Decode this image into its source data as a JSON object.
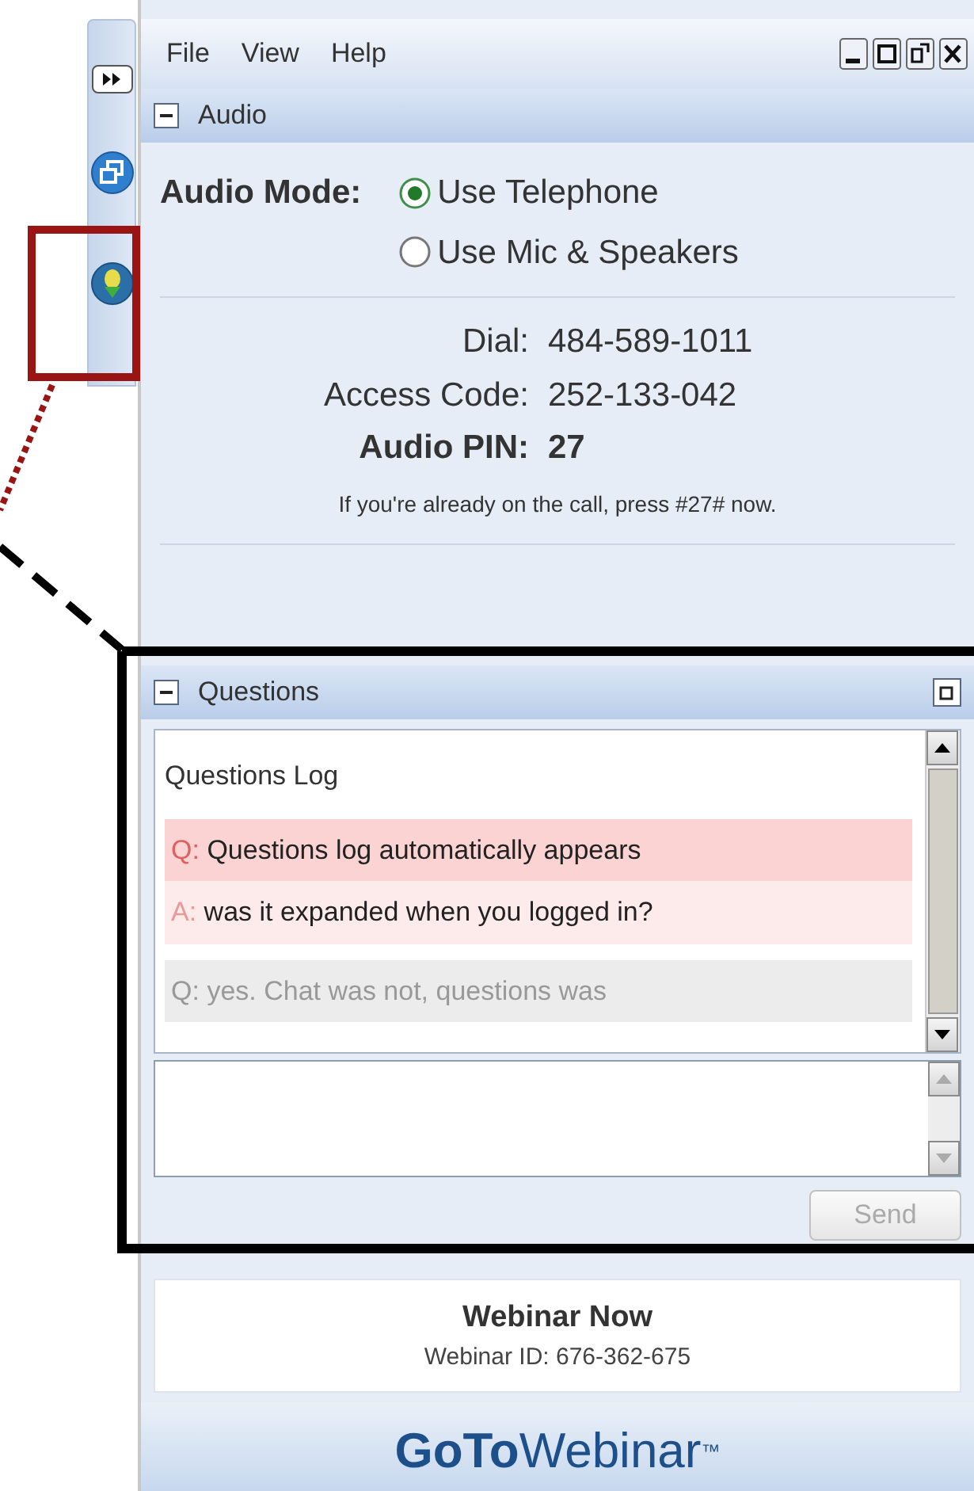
{
  "menu": [
    "File",
    "View",
    "Help"
  ],
  "audio": {
    "title": "Audio",
    "mode_label": "Audio Mode:",
    "options": [
      {
        "label": "Use Telephone",
        "selected": true
      },
      {
        "label": "Use Mic & Speakers",
        "selected": false
      }
    ],
    "details": [
      {
        "label": "Dial:",
        "value": "484-589-1011",
        "emphasis": false
      },
      {
        "label": "Access Code:",
        "value": "252-133-042",
        "emphasis": false
      },
      {
        "label": "Audio PIN:",
        "value": "27",
        "emphasis": true
      }
    ],
    "note": "If you're already on the call, press #27# now."
  },
  "questions": {
    "title": "Questions",
    "log_title": "Questions Log",
    "threads": [
      {
        "answered": true,
        "items": [
          {
            "prefix": "Q:",
            "text": "Questions log automatically appears",
            "kind": "question"
          },
          {
            "prefix": "A:",
            "text": "was it expanded when you logged in?",
            "kind": "answer"
          }
        ]
      },
      {
        "answered": false,
        "items": [
          {
            "prefix": "Q:",
            "text": "yes.  Chat was not, questions was",
            "kind": "question"
          }
        ]
      }
    ],
    "send": {
      "label": "Send",
      "disabled": true
    }
  },
  "footer": {
    "title": "Webinar Now",
    "webinar_id": "Webinar ID: 676-362-675"
  },
  "logo": {
    "strong": "GoTo",
    "light": "Webinar",
    "mark": "™"
  }
}
